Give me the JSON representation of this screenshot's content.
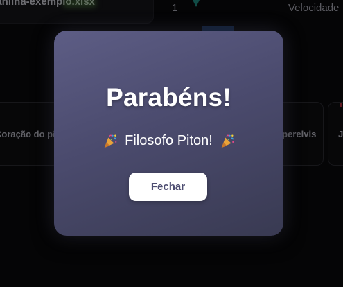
{
  "background": {
    "file_name": "planilha-exemplo.xlsx",
    "row_number": "1",
    "column_label": "Velocidade",
    "options": [
      {
        "label": "Coração do pão"
      },
      {
        "label": "Imperelvis"
      },
      {
        "label": "Jo"
      }
    ]
  },
  "modal": {
    "title": "Parabéns!",
    "message": "Filosofo Piton!",
    "icon_left": "party-popper-icon",
    "icon_right": "party-popper-icon",
    "close_label": "Fechar"
  },
  "colors": {
    "page_background": "#0a0a0c",
    "modal_gradient_start": "#5d5d85",
    "modal_gradient_end": "#393a52",
    "button_background": "#ffffff",
    "button_text": "#4e4e72"
  }
}
